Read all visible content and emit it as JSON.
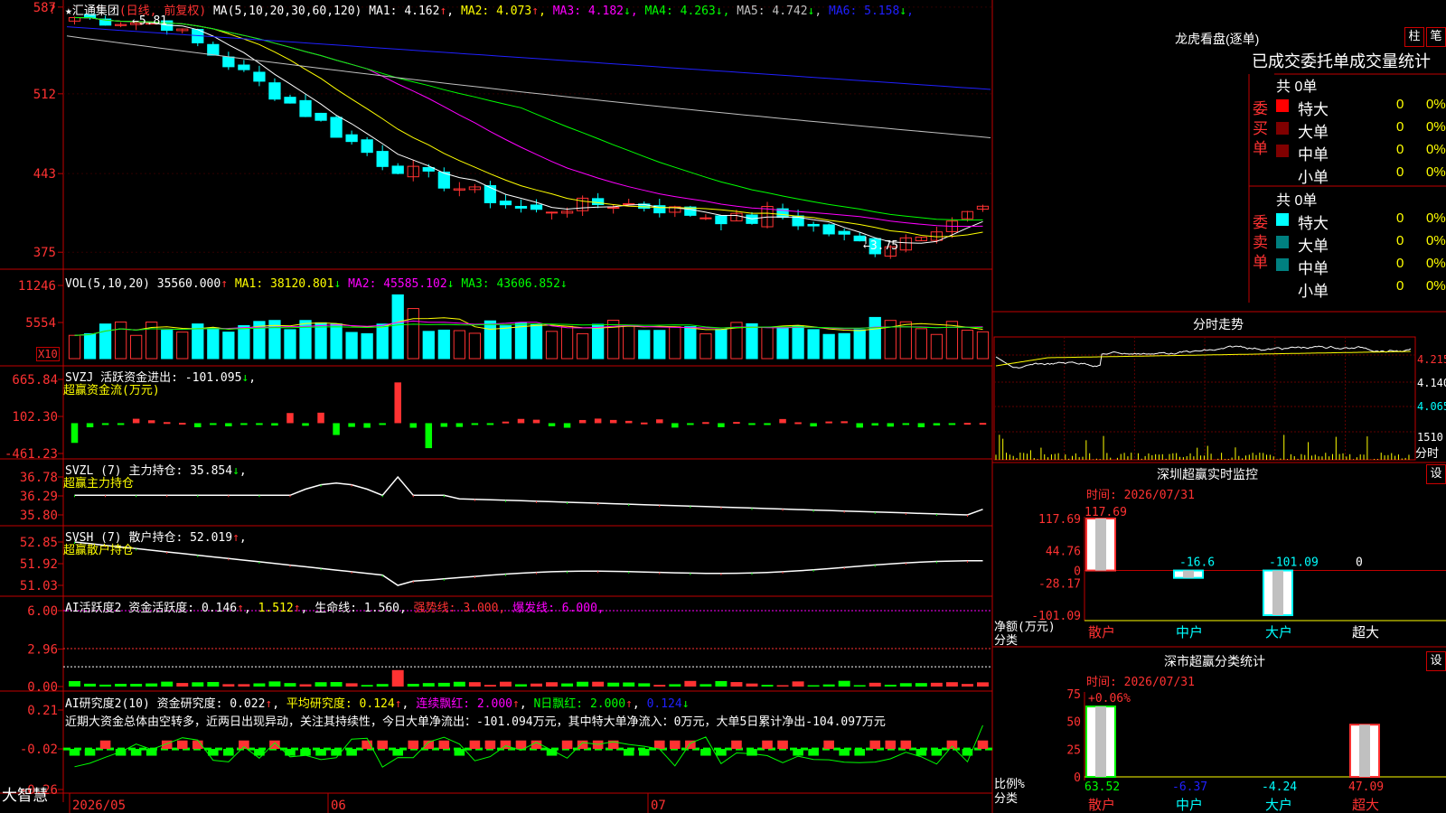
{
  "app": {
    "logo": "大智慧"
  },
  "colors": {
    "up": "#ff3232",
    "down": "#00ffff",
    "bg": "#000000",
    "frame": "#c00000",
    "ma1": "#ffffff",
    "ma2": "#ffff00",
    "ma3": "#ff00ff",
    "ma4": "#00ff00",
    "ma5": "#c0c0c0",
    "ma6": "#2020ff",
    "vol_ma1": "#ffff00",
    "vol_ma2": "#ff00ff",
    "vol_ma3": "#00ff00"
  },
  "main": {
    "stock_title": "★汇通集团(日线, 前复权)",
    "star": "★",
    "name": "汇通集团",
    "period": "(日线, 前复权)",
    "ma_prefix": "MA(5,10,20,30,60,120)",
    "ma": [
      {
        "label": "MA1:",
        "value": "4.162",
        "arrow": "↑"
      },
      {
        "label": "MA2:",
        "value": "4.073",
        "arrow": "↑"
      },
      {
        "label": "MA3:",
        "value": "4.182",
        "arrow": "↓"
      },
      {
        "label": "MA4:",
        "value": "4.263",
        "arrow": "↓"
      },
      {
        "label": "MA5:",
        "value": "4.742",
        "arrow": "↓"
      },
      {
        "label": "MA6:",
        "value": "5.158",
        "arrow": "↓"
      }
    ],
    "y_ticks": [
      "587",
      "512",
      "443",
      "375"
    ],
    "high_label": "5.81",
    "low_label": "3.75",
    "corner_mark": "?"
  },
  "vol": {
    "header": "VOL(5,10,20)",
    "value": "35560.000",
    "arrow": "↑",
    "ma": [
      {
        "label": "MA1:",
        "value": "38120.801",
        "arrow": "↓"
      },
      {
        "label": "MA2:",
        "value": "45585.102",
        "arrow": "↓"
      },
      {
        "label": "MA3:",
        "value": "43606.852",
        "arrow": "↓"
      }
    ],
    "y_ticks": [
      "11246",
      "5554"
    ],
    "unit": "X10"
  },
  "svzj": {
    "header": "SVZJ  活跃资金进出:",
    "value": "-101.095",
    "arrow": "↓",
    "sub": "超赢资金流(万元)",
    "y_ticks": [
      "665.84",
      "102.30",
      "-461.23"
    ]
  },
  "svzl": {
    "header": "SVZL (7) 主力持仓:",
    "value": "35.854",
    "arrow": "↓",
    "sub": "超赢主力持仓",
    "y_ticks": [
      "36.78",
      "36.29",
      "35.80"
    ]
  },
  "svsh": {
    "header": "SVSH (7) 散户持仓:",
    "value": "52.019",
    "arrow": "↑",
    "sub": "超赢散户持仓",
    "y_ticks": [
      "52.85",
      "51.92",
      "51.03"
    ]
  },
  "ai1": {
    "header": "AI活跃度2 资金活跃度:",
    "v1": "0.146",
    "v2": "1.512",
    "life": "生命线: 1.560,",
    "strong": "强势线: 3.000,",
    "burst": "爆发线: 6.000,",
    "y_ticks": [
      "6.00",
      "2.96",
      "0.00"
    ]
  },
  "ai2": {
    "header": "AI研究度2(10) 资金研究度:",
    "v1": "0.022",
    "avg": "平均研究度: 0.124",
    "lian": "连续飘红: 2.000",
    "n": "N日飘红: 2.000",
    "last": "0.124",
    "comment": "近期大资金总体由空转多，近两日出现异动，关注其持续性，今日大单净流出：-101.094万元，其中特大单净流入：0万元，大单5日累计净出-104.097万元",
    "y_ticks": [
      "0.21",
      "-0.02",
      "-0.26"
    ]
  },
  "xaxis": {
    "labels": [
      "2026/05",
      "06",
      "07"
    ]
  },
  "dragon": {
    "title": "龙虎看盘(逐单)",
    "btn1": "柱",
    "btn2": "笔",
    "heading": "已成交委托单成交量统计",
    "buy": {
      "side": "委买单",
      "total": "共 0单",
      "rows": [
        {
          "label": "特大",
          "count": "0",
          "pct": "0%"
        },
        {
          "label": "大单",
          "count": "0",
          "pct": "0%"
        },
        {
          "label": "中单",
          "count": "0",
          "pct": "0%"
        },
        {
          "label": "小单",
          "count": "0",
          "pct": "0%"
        }
      ]
    },
    "sell": {
      "side": "委卖单",
      "total": "共 0单",
      "rows": [
        {
          "label": "特大",
          "count": "0",
          "pct": "0%"
        },
        {
          "label": "大单",
          "count": "0",
          "pct": "0%"
        },
        {
          "label": "中单",
          "count": "0",
          "pct": "0%"
        },
        {
          "label": "小单",
          "count": "0",
          "pct": "0%"
        }
      ]
    }
  },
  "intraday": {
    "title": "分时走势",
    "y_ticks": [
      "4.215",
      "4.140",
      "4.065"
    ],
    "vol_tick": "1510",
    "unit": "分时"
  },
  "sz_monitor": {
    "title": "深圳超赢实时监控",
    "set": "设",
    "time": "时间: 2026/07/31",
    "y_ticks": [
      "117.69",
      "44.76",
      "0",
      "-28.17",
      "-101.09"
    ],
    "ylabel": "净额(万元)",
    "xlabel": "分类",
    "bars": [
      {
        "cat": "散户",
        "value": 117.69,
        "label": "117.69"
      },
      {
        "cat": "中户",
        "value": -16.6,
        "label": "-16.6"
      },
      {
        "cat": "大户",
        "value": -101.09,
        "label": "-101.09"
      },
      {
        "cat": "超大",
        "value": 0,
        "label": "0"
      }
    ]
  },
  "sz_class": {
    "title": "深市超赢分类统计",
    "set": "设",
    "time": "时间: 2026/07/31",
    "y_ticks": [
      "75",
      "50",
      "25",
      "0"
    ],
    "ylabel": "比例%",
    "xlabel": "分类",
    "top_label": "+0.06%",
    "bars": [
      {
        "cat": "散户",
        "value": 63.52,
        "label": "63.52"
      },
      {
        "cat": "中户",
        "value": -6.37,
        "label": "-6.37"
      },
      {
        "cat": "大户",
        "value": -4.24,
        "label": "-4.24"
      },
      {
        "cat": "超大",
        "value": 47.09,
        "label": "47.09"
      }
    ]
  }
}
